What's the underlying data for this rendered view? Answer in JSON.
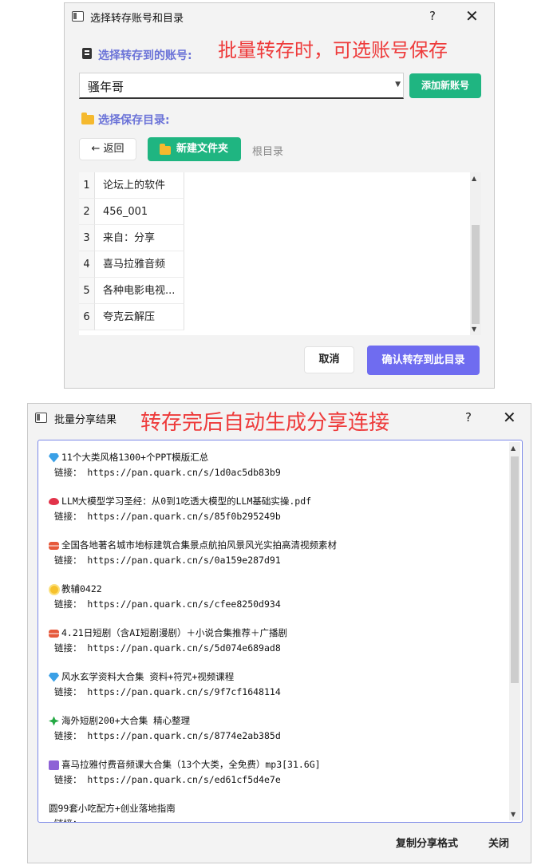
{
  "dialog1": {
    "title": "选择转存账号和目录",
    "help": "?",
    "close": "✕",
    "annotation": "批量转存时，可选账号保存",
    "account_label": "选择转存到的账号:",
    "account_value": "骚年哥",
    "add_account_label": "添加新账号",
    "dir_label": "选择保存目录:",
    "back_label": "← 返回",
    "new_folder_label": "新建文件夹",
    "root_label": "根目录",
    "rows": [
      {
        "num": "1",
        "name": "论坛上的软件"
      },
      {
        "num": "2",
        "name": "456_001"
      },
      {
        "num": "3",
        "name": "来自：分享"
      },
      {
        "num": "4",
        "name": "喜马拉雅音频"
      },
      {
        "num": "5",
        "name": "各种电影电视..."
      },
      {
        "num": "6",
        "name": "夸克云解压"
      }
    ],
    "cancel_label": "取消",
    "confirm_label": "确认转存到此目录"
  },
  "dialog2": {
    "title": "批量分享结果",
    "help": "?",
    "close": "✕",
    "annotation": "转存完后自动生成分享连接",
    "entries": [
      {
        "icon": "diamond-icon",
        "title": "11个大类风格1300+个PPT模版汇总",
        "link": "链接： https://pan.quark.cn/s/1d0ac5db83b9"
      },
      {
        "icon": "lips-icon",
        "title": "LLM大模型学习圣经：从0到1吃透大模型的LLM基础实操.pdf",
        "link": "链接： https://pan.quark.cn/s/85f0b295249b"
      },
      {
        "icon": "sushi-icon",
        "title": "全国各地著名城市地标建筑合集景点航拍风景风光实拍高清视频素材",
        "link": "链接： https://pan.quark.cn/s/0a159e287d91"
      },
      {
        "icon": "sun-icon",
        "title": "教辅0422",
        "link": "链接： https://pan.quark.cn/s/cfee8250d934"
      },
      {
        "icon": "sushi-icon",
        "title": "4.21日短剧（含AI短剧漫剧）＋小说合集推荐＋广播剧",
        "link": "链接： https://pan.quark.cn/s/5d074e689ad8"
      },
      {
        "icon": "diamond-icon",
        "title": "风水玄学资料大合集 资料+符咒+视频课程",
        "link": "链接： https://pan.quark.cn/s/9f7cf1648114"
      },
      {
        "icon": "clover-icon",
        "title": "海外短剧200+大合集 精心整理",
        "link": "链接： https://pan.quark.cn/s/8774e2ab385d"
      },
      {
        "icon": "purple-icon",
        "title": "喜马拉雅付费音频课大合集（13个大类，全免费）mp3[31.6G]",
        "link": "链接： https://pan.quark.cn/s/ed61cf5d4e7e"
      }
    ],
    "partial_title": "圆99套小吃配方+创业落地指南",
    "partial_link": "链接：",
    "copy_label": "复制分享格式",
    "close_label": "关闭"
  },
  "colors": {
    "accent_green": "#1fb581",
    "accent_purple": "#6f6cf0",
    "label_purple": "#6b73d8",
    "annotation_red": "#ee3b3b"
  }
}
